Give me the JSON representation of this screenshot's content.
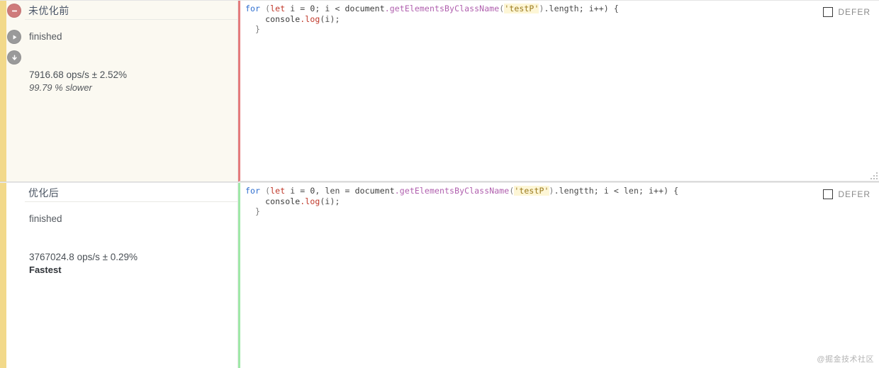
{
  "rows": [
    {
      "title": "未优化前",
      "status": "finished",
      "ops": "7916.68 ops/s ± 2.52%",
      "rank": "99.79 % slower",
      "rank_style": "slower",
      "accent_color": "#f2d98a",
      "code_border_color": "#e47c7c",
      "icons": [
        {
          "name": "remove-test-icon",
          "glyph": "minus",
          "color": "#cf7b7b"
        },
        {
          "name": "run-test-icon",
          "glyph": "play",
          "color": "#9a9a9a"
        },
        {
          "name": "move-down-icon",
          "glyph": "arrow-down",
          "color": "#9a9a9a"
        }
      ],
      "code": {
        "line1": [
          {
            "t": "for",
            "c": "kw"
          },
          {
            "t": " (",
            "c": "punct"
          },
          {
            "t": "let",
            "c": "let"
          },
          {
            "t": " i = ",
            "c": "plain"
          },
          {
            "t": "0",
            "c": "num"
          },
          {
            "t": "; i < ",
            "c": "plain"
          },
          {
            "t": "document",
            "c": "ident"
          },
          {
            "t": ".getElementsByClassName",
            "c": "member"
          },
          {
            "t": "(",
            "c": "punct"
          },
          {
            "t": "'testP'",
            "c": "str"
          },
          {
            "t": ")",
            "c": "punct"
          },
          {
            "t": ".length",
            "c": "plain"
          },
          {
            "t": "; i++) {",
            "c": "plain"
          }
        ],
        "line2": [
          {
            "t": "    ",
            "c": "plain"
          },
          {
            "t": "console",
            "c": "ident"
          },
          {
            "t": ".log",
            "c": "method"
          },
          {
            "t": "(i);",
            "c": "plain"
          }
        ],
        "line3": [
          {
            "t": "  }",
            "c": "punct"
          }
        ]
      },
      "defer_label": "DEFER",
      "defer_checked": false,
      "has_resize_grip": true
    },
    {
      "title": "优化后",
      "status": "finished",
      "ops": "3767024.8 ops/s ± 0.29%",
      "rank": "Fastest",
      "rank_style": "fastest",
      "accent_color": "#f2d98a",
      "code_border_color": "#9fe8a8",
      "icons": [],
      "code": {
        "line1": [
          {
            "t": "for",
            "c": "kw"
          },
          {
            "t": " (",
            "c": "punct"
          },
          {
            "t": "let",
            "c": "let"
          },
          {
            "t": " i = ",
            "c": "plain"
          },
          {
            "t": "0",
            "c": "num"
          },
          {
            "t": ", len = ",
            "c": "plain"
          },
          {
            "t": "document",
            "c": "ident"
          },
          {
            "t": ".getElementsByClassName",
            "c": "member"
          },
          {
            "t": "(",
            "c": "punct"
          },
          {
            "t": "'testP'",
            "c": "str"
          },
          {
            "t": ")",
            "c": "punct"
          },
          {
            "t": ".lengtth",
            "c": "plain"
          },
          {
            "t": "; i < len; i++) {",
            "c": "plain"
          }
        ],
        "line2": [
          {
            "t": "    ",
            "c": "plain"
          },
          {
            "t": "console",
            "c": "ident"
          },
          {
            "t": ".log",
            "c": "method"
          },
          {
            "t": "(i);",
            "c": "plain"
          }
        ],
        "line3": [
          {
            "t": "  }",
            "c": "punct"
          }
        ]
      },
      "defer_label": "DEFER",
      "defer_checked": false,
      "has_resize_grip": false
    }
  ],
  "watermark": "@掘金技术社区"
}
